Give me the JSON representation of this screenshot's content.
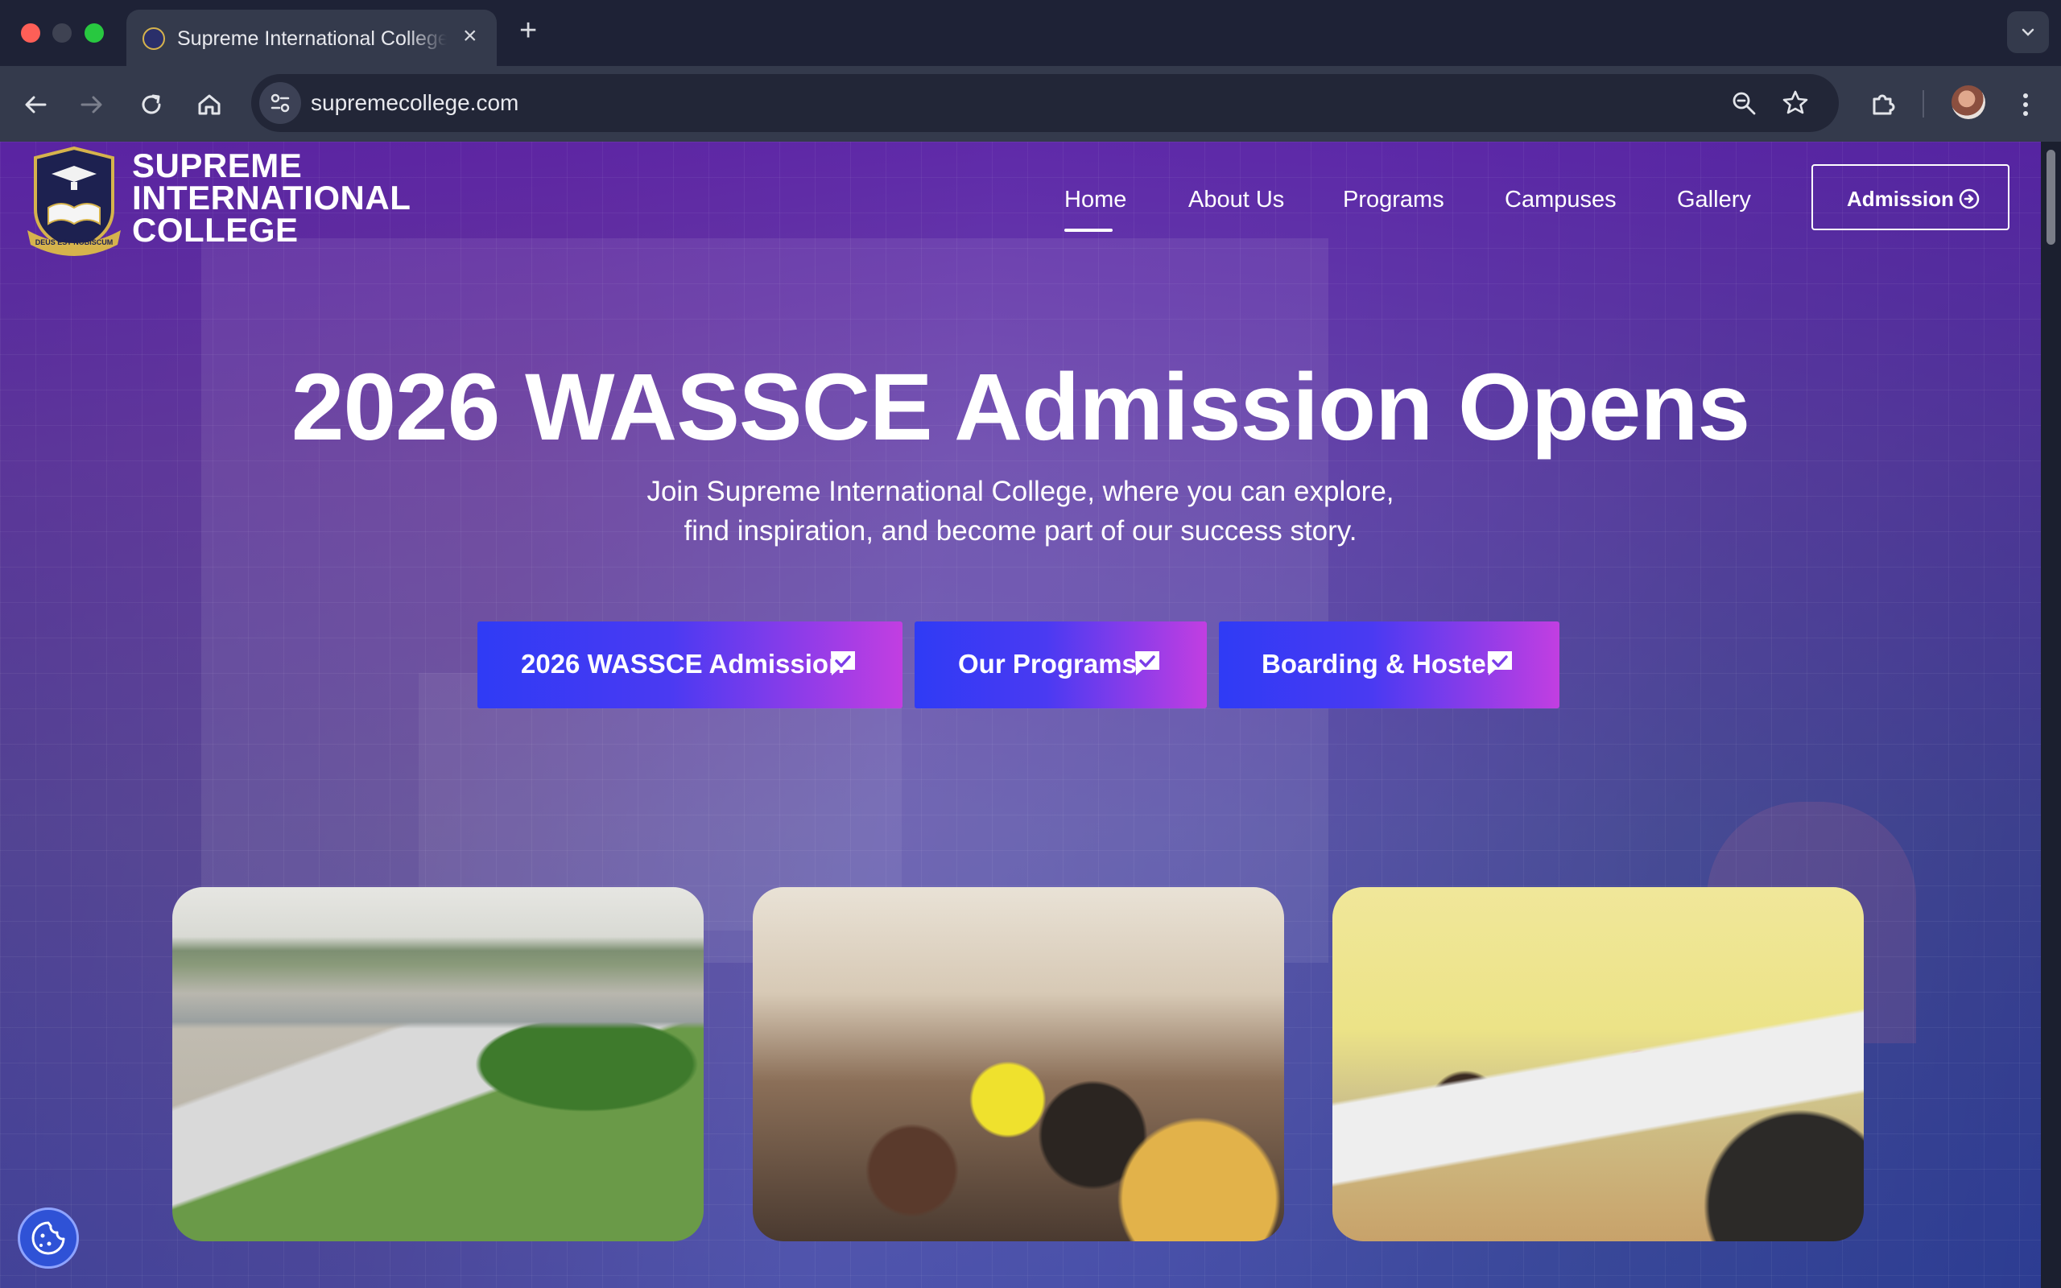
{
  "browser": {
    "tab_title": "Supreme International College",
    "url": "supremecollege.com",
    "close_glyph": "×",
    "new_tab_glyph": "+",
    "tab_menu_glyph": "⌄",
    "icons": [
      "back-icon",
      "forward-icon",
      "reload-icon",
      "home-icon",
      "site-info-icon",
      "zoom-icon",
      "bookmark-star-icon",
      "extensions-icon",
      "profile-avatar",
      "more-menu-icon"
    ]
  },
  "site": {
    "brand_lines": [
      "SUPREME",
      "INTERNATIONAL",
      "COLLEGE"
    ],
    "logo_motto": "DEUS EST NOBISCUM",
    "nav": [
      {
        "label": "Home",
        "active": true
      },
      {
        "label": "About Us"
      },
      {
        "label": "Programs"
      },
      {
        "label": "Campuses"
      },
      {
        "label": "Gallery"
      }
    ],
    "admission_button": "Admission"
  },
  "hero": {
    "title": "2026 WASSCE Admission Opens",
    "subtitle_lines": [
      "Join Supreme International College, where you can explore,",
      "find inspiration, and become part of our success story."
    ],
    "buttons": [
      {
        "label": "2026 WASSCE Admission"
      },
      {
        "label": "Our Programs"
      },
      {
        "label": "Boarding & Hostel"
      }
    ]
  },
  "colors": {
    "overlay_purple": "#5a1ea8",
    "cta_start": "#2f3bf5",
    "cta_end": "#c23ee1",
    "cookie_button": "#2f52d6"
  }
}
